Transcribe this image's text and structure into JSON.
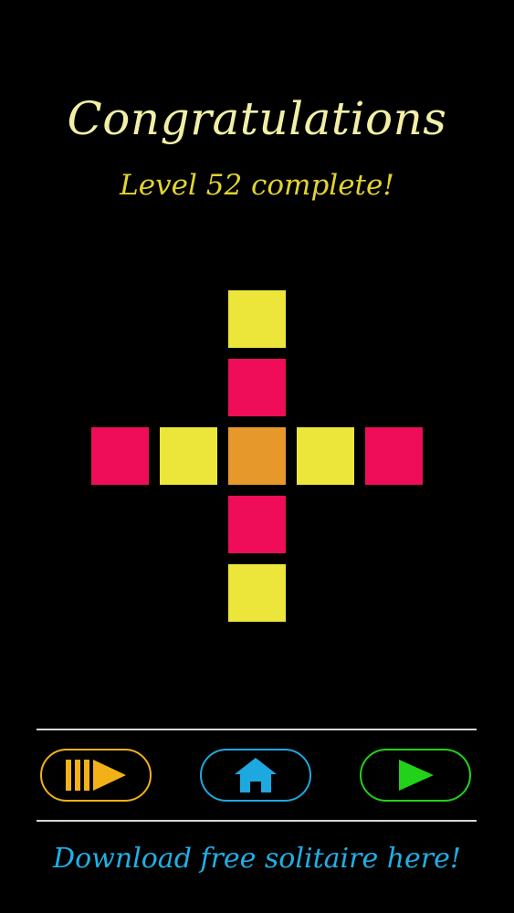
{
  "header": {
    "title": "Congratulations",
    "subtitle": "Level 52 complete!"
  },
  "board": {
    "colors": {
      "yellow": "#ece63a",
      "pink": "#ef0c58",
      "orange": "#e7982b"
    },
    "tiles": [
      {
        "row": 0,
        "col": 2,
        "color": "yellow"
      },
      {
        "row": 1,
        "col": 2,
        "color": "pink"
      },
      {
        "row": 2,
        "col": 0,
        "color": "pink"
      },
      {
        "row": 2,
        "col": 1,
        "color": "yellow"
      },
      {
        "row": 2,
        "col": 2,
        "color": "orange"
      },
      {
        "row": 2,
        "col": 3,
        "color": "yellow"
      },
      {
        "row": 2,
        "col": 4,
        "color": "pink"
      },
      {
        "row": 3,
        "col": 2,
        "color": "pink"
      },
      {
        "row": 4,
        "col": 2,
        "color": "yellow"
      }
    ]
  },
  "buttons": {
    "levels": {
      "icon": "level-select-icon",
      "color": "#f2b117"
    },
    "home": {
      "icon": "home-icon",
      "color": "#1ea8e0"
    },
    "next": {
      "icon": "play-icon",
      "color": "#22d11a"
    }
  },
  "divider_color": "#d8d8d8",
  "footer": {
    "link_text": "Download free solitaire here!"
  }
}
